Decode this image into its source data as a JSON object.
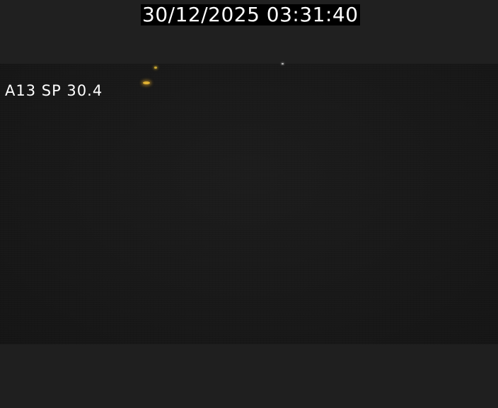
{
  "overlay": {
    "timestamp": "30/12/2025 03:31:40",
    "camera_label": "A13 SP 30.4"
  },
  "colors": {
    "background": "#1f1f1f",
    "scene": "#181818",
    "text": "#ffffff",
    "timestamp_background": "#000000",
    "light_amber": "#e0b233"
  }
}
